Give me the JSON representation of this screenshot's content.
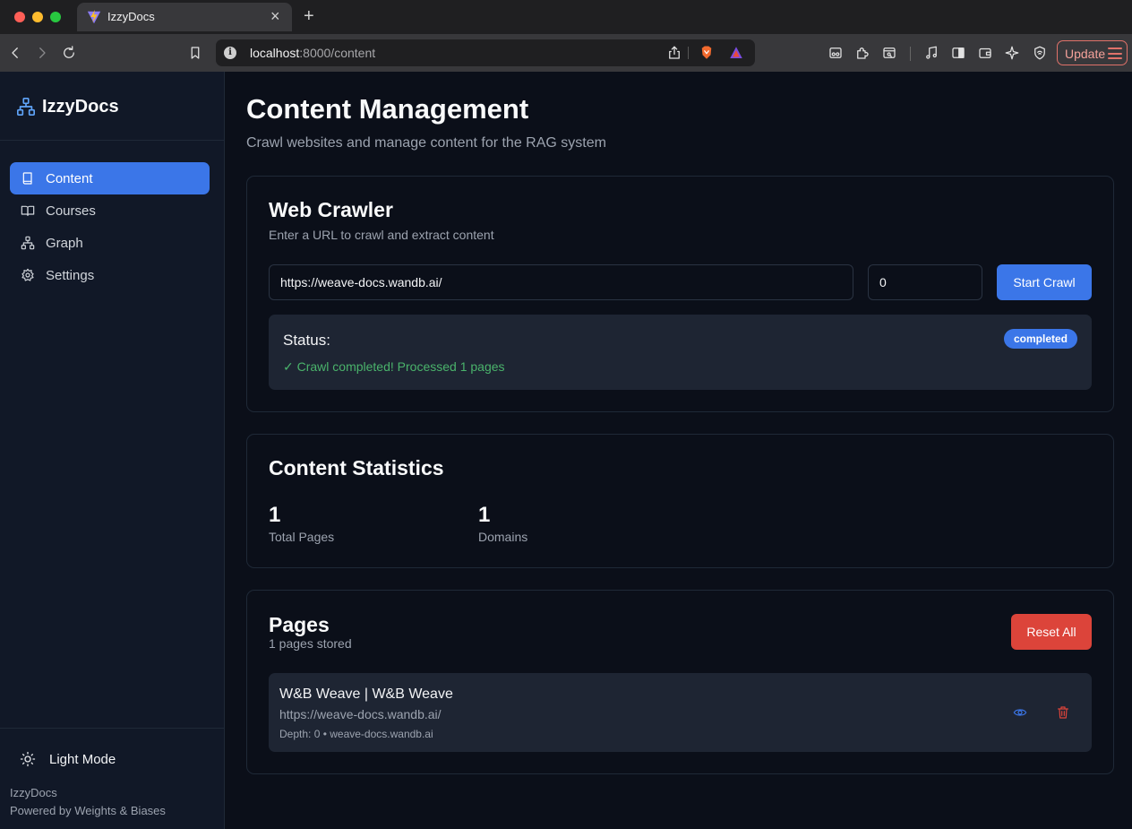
{
  "browser": {
    "tab_title": "IzzyDocs",
    "tab_close": "×",
    "new_tab": "+",
    "url_host": "localhost",
    "url_path": ":8000/content",
    "update_label": "Update"
  },
  "sidebar": {
    "brand": "IzzyDocs",
    "items": [
      {
        "label": "Content",
        "icon": "book-icon",
        "active": true
      },
      {
        "label": "Courses",
        "icon": "book-open-icon",
        "active": false
      },
      {
        "label": "Graph",
        "icon": "network-icon",
        "active": false
      },
      {
        "label": "Settings",
        "icon": "gear-icon",
        "active": false
      }
    ],
    "theme_toggle": "Light Mode",
    "footer_name": "IzzyDocs",
    "footer_powered": "Powered by Weights & Biases"
  },
  "header": {
    "title": "Content Management",
    "subtitle": "Crawl websites and manage content for the RAG system"
  },
  "crawler": {
    "title": "Web Crawler",
    "description": "Enter a URL to crawl and extract content",
    "url_value": "https://weave-docs.wandb.ai/",
    "depth_value": "0",
    "start_label": "Start Crawl",
    "status_label": "Status:",
    "status_badge": "completed",
    "status_message": "✓ Crawl completed! Processed 1 pages"
  },
  "stats": {
    "title": "Content Statistics",
    "total_pages_value": "1",
    "total_pages_label": "Total Pages",
    "domains_value": "1",
    "domains_label": "Domains"
  },
  "pages": {
    "title": "Pages",
    "count_text": "1 pages stored",
    "reset_label": "Reset All",
    "items": [
      {
        "title": "W&B Weave | W&B Weave",
        "url": "https://weave-docs.wandb.ai/",
        "meta": "Depth: 0 • weave-docs.wandb.ai"
      }
    ]
  },
  "colors": {
    "accent": "#3b76e8",
    "danger": "#dc443a",
    "success": "#4ab36b",
    "sidebar_bg": "#111827",
    "page_bg": "#0b0f19"
  }
}
